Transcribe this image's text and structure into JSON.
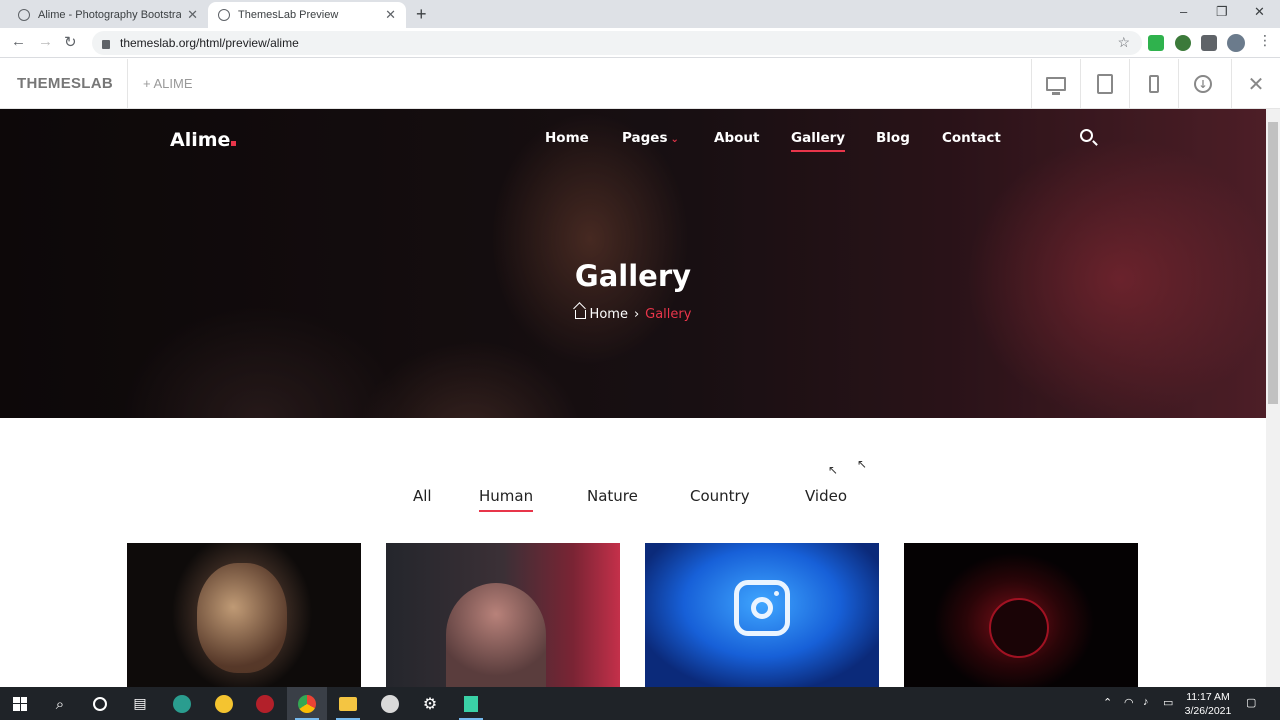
{
  "browser": {
    "tabs": [
      {
        "title": "Alime - Photography Bootstrap H",
        "active": false
      },
      {
        "title": "ThemesLab Preview",
        "active": true
      }
    ],
    "new_tab_label": "+",
    "url": "themeslab.org/html/preview/alime",
    "window_controls": {
      "minimize": "–",
      "maximize": "❐",
      "close": "✕"
    }
  },
  "preview_bar": {
    "brand": "THEMESLAB",
    "project": "+ ALIME",
    "devices": [
      "desktop-icon",
      "tablet-icon",
      "phone-icon",
      "download-icon",
      "close-icon"
    ]
  },
  "site": {
    "logo": "Alime",
    "nav": [
      {
        "label": "Home"
      },
      {
        "label": "Pages",
        "has_dropdown": true
      },
      {
        "label": "About"
      },
      {
        "label": "Gallery",
        "active": true
      },
      {
        "label": "Blog"
      },
      {
        "label": "Contact"
      }
    ],
    "hero": {
      "title": "Gallery",
      "breadcrumb_home": "Home",
      "breadcrumb_sep": "›",
      "breadcrumb_current": "Gallery"
    },
    "filters": [
      {
        "label": "All"
      },
      {
        "label": "Human",
        "active": true
      },
      {
        "label": "Nature"
      },
      {
        "label": "Country"
      },
      {
        "label": "Video"
      }
    ],
    "accent_color": "#e8354a"
  },
  "taskbar": {
    "time": "11:17 AM",
    "date": "3/26/2021"
  }
}
